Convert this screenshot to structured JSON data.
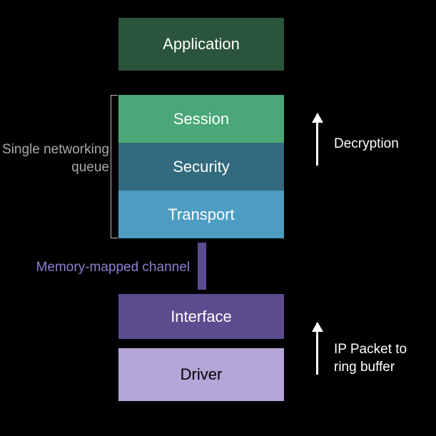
{
  "layers": {
    "application": "Application",
    "session": "Session",
    "security": "Security",
    "transport": "Transport",
    "interface": "Interface",
    "driver": "Driver"
  },
  "annotations": {
    "queue_label": "Single networking queue",
    "channel_label": "Memory-mapped channel",
    "decryption_label": "Decryption",
    "ip_packet_label": "IP Packet to ring buffer"
  }
}
